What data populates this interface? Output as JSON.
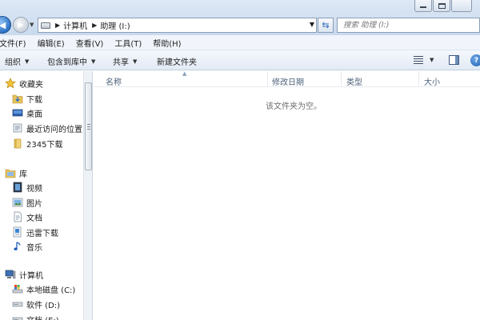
{
  "window": {
    "controls": [
      {
        "name": "minimize"
      },
      {
        "name": "maximize"
      },
      {
        "name": "close"
      }
    ]
  },
  "address_bar": {
    "back_glyph": "◀",
    "forward_glyph": "▶",
    "segments": [
      "计算机",
      "助理 (I:)"
    ],
    "separator_glyph": "▶",
    "dropdown_glyph": "▼",
    "refresh_glyph": "⇆"
  },
  "search": {
    "placeholder": "搜索 助理 (I:)"
  },
  "menu": {
    "file": "文件(F)",
    "edit": "编辑(E)",
    "view": "查看(V)",
    "tools": "工具(T)",
    "help": "帮助(H)"
  },
  "command_bar": {
    "organize": "组织",
    "include_in_library": "包含到库中",
    "share": "共享",
    "new_folder": "新建文件夹",
    "caret_glyph": "▼",
    "help_glyph": "?"
  },
  "nav_pane": {
    "favorites": {
      "label": "收藏夹",
      "items": [
        "下载",
        "桌面",
        "最近访问的位置",
        "2345下载"
      ]
    },
    "libraries": {
      "label": "库",
      "items": [
        "视频",
        "图片",
        "文档",
        "迅雷下载",
        "音乐"
      ]
    },
    "computer": {
      "label": "计算机",
      "items": [
        "本地磁盘 (C:)",
        "软件 (D:)",
        "文档 (E:)"
      ]
    }
  },
  "content": {
    "columns": [
      "名称",
      "修改日期",
      "类型",
      "大小"
    ],
    "sort_glyph": "▲",
    "empty_message": "该文件夹为空。"
  },
  "colors": {
    "accent": "#2d72c6",
    "header_text": "#4c607a",
    "chrome": "#d3e1f1"
  }
}
